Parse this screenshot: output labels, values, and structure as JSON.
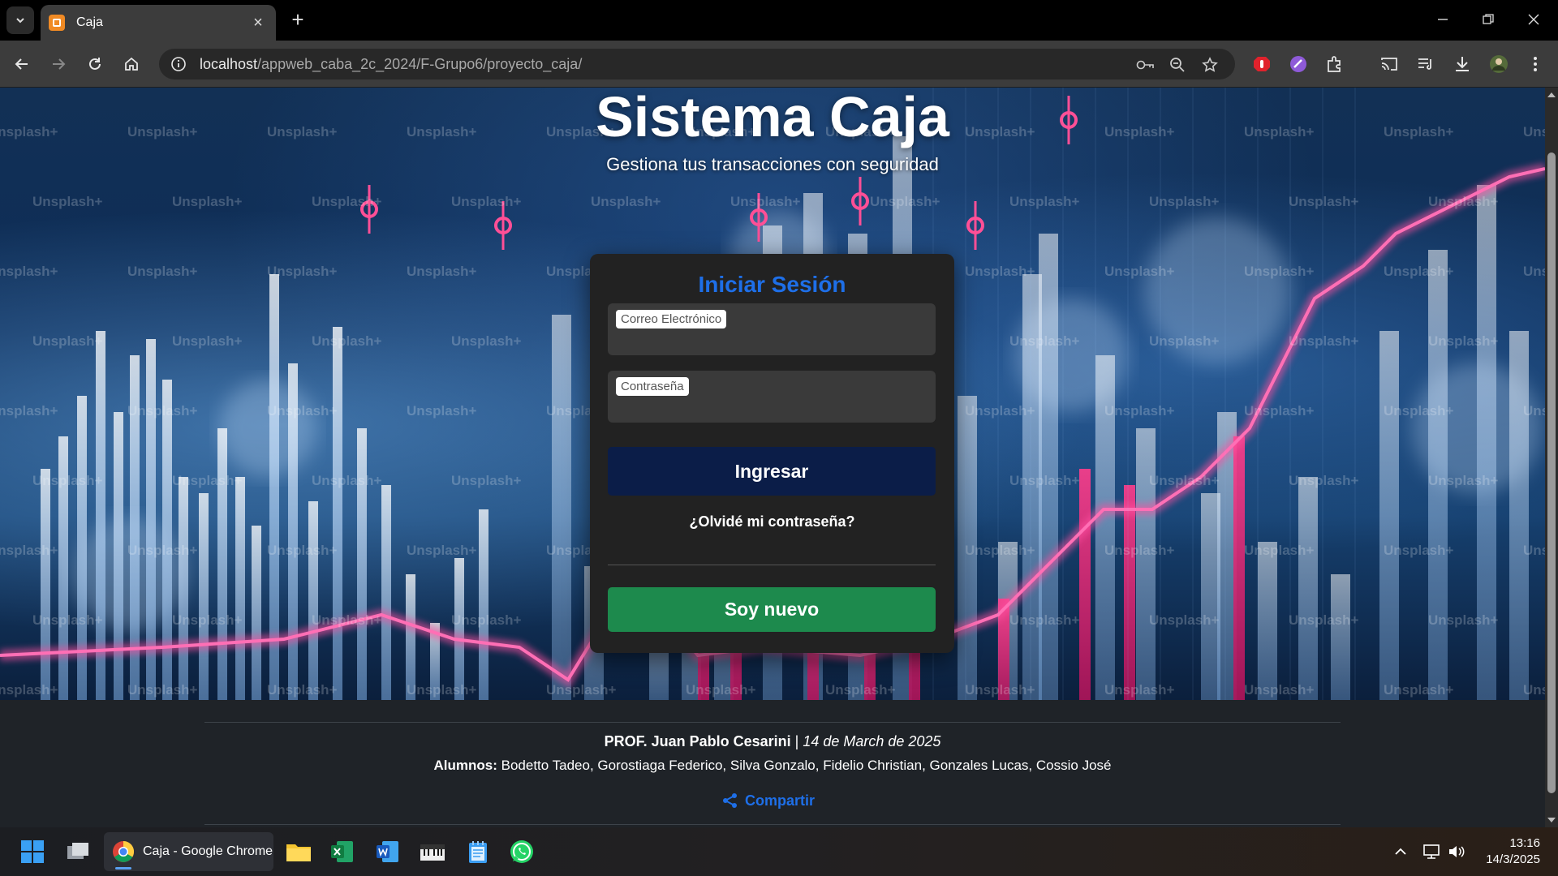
{
  "browser": {
    "tab_title": "Caja",
    "url_host": "localhost",
    "url_path": "/appweb_caba_2c_2024/F-Grupo6/proyecto_caja/"
  },
  "hero": {
    "title": "Sistema Caja",
    "subtitle": "Gestiona tus transacciones con seguridad",
    "watermark": "Unsplash+"
  },
  "login": {
    "heading": "Iniciar Sesión",
    "email_label": "Correo Electrónico",
    "password_label": "Contraseña",
    "submit_label": "Ingresar",
    "forgot_label": "¿Olvidé mi contraseña?",
    "register_label": "Soy nuevo"
  },
  "footer": {
    "prof": "PROF. Juan Pablo Cesarini",
    "separator": " | ",
    "date": "14 de March de 2025",
    "students_label": "Alumnos:",
    "students": " Bodetto Tadeo, Gorostiaga Federico, Silva Gonzalo, Fidelio Christian, Gonzales Lucas, Cossio José",
    "share_label": "Compartir"
  },
  "taskbar": {
    "chrome_label": "Caja - Google Chrome",
    "time": "13:16",
    "date": "14/3/2025"
  },
  "colors": {
    "accent_blue": "#1e6fe8",
    "login_button": "#0b1d48",
    "register_button": "#1d8a4d",
    "card_bg": "#222222"
  }
}
